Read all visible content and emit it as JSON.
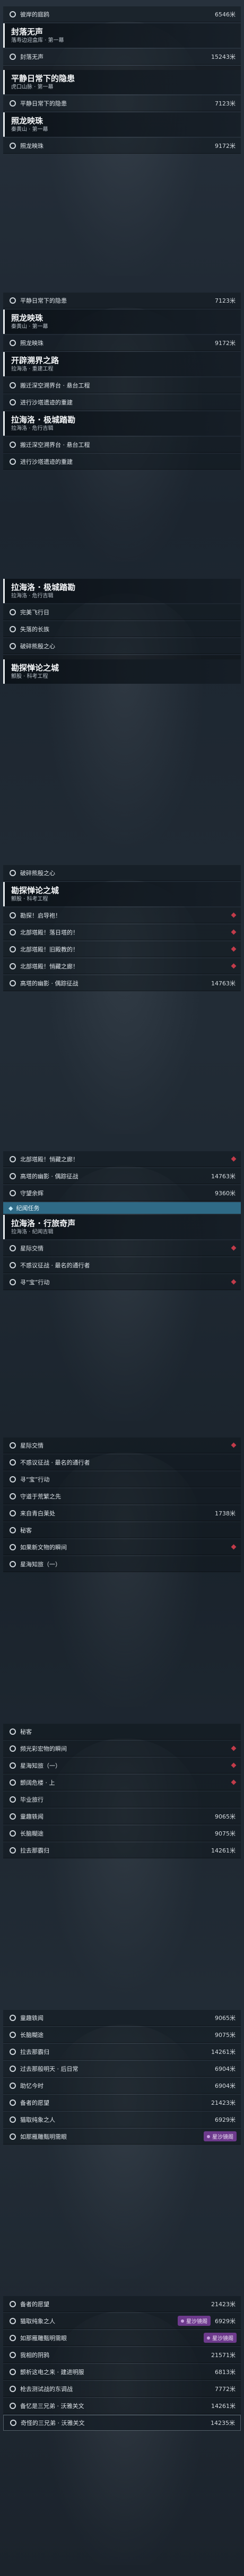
{
  "screens": [
    {
      "rows": [
        {
          "type": "row",
          "icon": "o",
          "text": "彼岸的庭鸥",
          "dist": "6546米"
        },
        {
          "type": "hdr",
          "title": "封落无声",
          "sub": "落寿边迎盒库 · 第一幕"
        },
        {
          "type": "row",
          "icon": "o",
          "text": "封落无声",
          "dist": "15243米"
        },
        {
          "type": "gap"
        },
        {
          "type": "hdr",
          "title": "平静日常下的隐患",
          "sub": "虎口山脉 · 第一幕"
        },
        {
          "type": "row",
          "icon": "o",
          "text": "平静日常下的隐患",
          "dist": "7123米"
        },
        {
          "type": "hdr",
          "title": "照龙映珠",
          "sub": "秦黄山 · 第一幕"
        },
        {
          "type": "row",
          "icon": "o",
          "text": "照龙映珠",
          "dist": "9172米"
        }
      ]
    },
    {
      "rows": [
        {
          "type": "row",
          "icon": "o",
          "text": "平静日常下的隐患",
          "dist": "7123米"
        },
        {
          "type": "hdr",
          "title": "照龙映珠",
          "sub": "秦黄山 · 第一幕"
        },
        {
          "type": "row",
          "icon": "o",
          "text": "照龙映珠",
          "dist": "9172米"
        },
        {
          "type": "hdr",
          "title": "开辟溯界之路",
          "sub": "拉海洛 · 重建工程"
        },
        {
          "type": "row",
          "icon": "o",
          "text": "搬迁深空溯界台 · 悬台工程"
        },
        {
          "type": "row",
          "icon": "o",
          "text": "进行沙塔遗迹的重建"
        },
        {
          "type": "hdr",
          "title": "拉海洛 · 极城踏勘",
          "sub": "拉海洛 · 危行吉辑"
        },
        {
          "type": "row",
          "icon": "o",
          "text": "搬迁深空溯界台 · 悬台工程"
        },
        {
          "type": "row",
          "icon": "o",
          "text": "进行沙塔遗迹的重建"
        }
      ]
    },
    {
      "rows": [
        {
          "type": "hdr",
          "title": "拉海洛 · 极城踏勘",
          "sub": "拉海洛 · 危行吉辑"
        },
        {
          "type": "row",
          "icon": "o",
          "text": "完美飞行日"
        },
        {
          "type": "row",
          "icon": "o",
          "text": "失落的长族"
        },
        {
          "type": "row",
          "icon": "o",
          "text": "破碎熊殷之心"
        },
        {
          "type": "gap"
        },
        {
          "type": "hdr",
          "title": "勘探惮论之城",
          "sub": "颤股 · 科考工程"
        }
      ]
    },
    {
      "rows": [
        {
          "type": "row",
          "icon": "o",
          "text": "破碎熊殷之心"
        },
        {
          "type": "hdr",
          "title": "勘探惮论之城",
          "sub": "颤股 · 科考工程"
        },
        {
          "type": "row",
          "icon": "o",
          "text": "勘探！启导袍！",
          "mark": true
        },
        {
          "type": "row",
          "icon": "o",
          "text": "北部塔殿！落日塔的！",
          "mark": true
        },
        {
          "type": "row",
          "icon": "o",
          "text": "北部塔殿！旧殿教的！",
          "mark": true
        },
        {
          "type": "row",
          "icon": "o",
          "text": "北部塔殿！悄藏之廊！",
          "mark": true
        },
        {
          "type": "row",
          "icon": "o",
          "text": "高塔的幽影 · 偶踪征战",
          "dist": "14763米"
        }
      ]
    },
    {
      "rows": [
        {
          "type": "row",
          "icon": "o",
          "text": "北部塔殿！悄藏之廊！",
          "mark": true
        },
        {
          "type": "row",
          "icon": "o",
          "text": "高塔的幽影 · 偶踪征战",
          "dist": "14763米"
        },
        {
          "type": "row",
          "icon": "o",
          "text": "守望余辉",
          "dist": "9360米"
        },
        {
          "type": "tag",
          "text": "纪闻任务"
        },
        {
          "type": "hdr",
          "title": "拉海洛 · 行旅奇声",
          "sub": "拉海洛 · 纪闻吉辑"
        },
        {
          "type": "row",
          "icon": "o",
          "text": "星际交情",
          "mark": true
        },
        {
          "type": "row",
          "icon": "o",
          "text": "不惑议征战 · 最名的通行者"
        },
        {
          "type": "row",
          "icon": "o",
          "text": "寻“宝”行动",
          "mark": true
        }
      ]
    },
    {
      "rows": [
        {
          "type": "row",
          "icon": "o",
          "text": "星际交情",
          "mark": true
        },
        {
          "type": "row",
          "icon": "o",
          "text": "不惑议征战 · 最名的通行者"
        },
        {
          "type": "row",
          "icon": "o",
          "text": "寻“宝”行动"
        },
        {
          "type": "row",
          "icon": "o",
          "text": "守道于荒繁之先"
        },
        {
          "type": "row",
          "icon": "o",
          "text": "来自青白莱处",
          "dist": "1738米"
        },
        {
          "type": "row",
          "icon": "o",
          "text": "秘客"
        },
        {
          "type": "row",
          "icon": "o",
          "text": "如果新文物的瞬间",
          "mark": true
        },
        {
          "type": "row",
          "icon": "o",
          "text": "星海知旅（一）"
        }
      ]
    },
    {
      "rows": [
        {
          "type": "row",
          "icon": "o",
          "text": "秘客"
        },
        {
          "type": "row",
          "icon": "o",
          "text": "频光彩宏物的瞬间",
          "mark": true
        },
        {
          "type": "row",
          "icon": "o",
          "text": "星海知旅（一）",
          "mark": true
        },
        {
          "type": "row",
          "icon": "o",
          "text": "颤阔危楼 · 上",
          "mark": true
        },
        {
          "type": "row",
          "icon": "o",
          "text": "毕业旅行"
        },
        {
          "type": "row",
          "icon": "o",
          "text": "童趣轶闻",
          "dist": "9065米"
        },
        {
          "type": "row",
          "icon": "o",
          "text": "长脑糊途",
          "dist": "9075米"
        },
        {
          "type": "row",
          "icon": "o",
          "text": "拉去那霸归",
          "dist": "14261米"
        }
      ]
    },
    {
      "rows": [
        {
          "type": "row",
          "icon": "o",
          "text": "童趣轶闻",
          "dist": "9065米"
        },
        {
          "type": "row",
          "icon": "o",
          "text": "长脑糊途",
          "dist": "9075米"
        },
        {
          "type": "row",
          "icon": "o",
          "text": "拉去那霸归",
          "dist": "14261米"
        },
        {
          "type": "row",
          "icon": "o",
          "text": "过去那般明天 · 后日常",
          "dist": "6904米"
        },
        {
          "type": "row",
          "icon": "o",
          "text": "助忆今时",
          "dist": "6904米"
        },
        {
          "type": "row",
          "icon": "o",
          "text": "备者的愿望",
          "dist": "21423米"
        },
        {
          "type": "row",
          "icon": "o",
          "text": "猫取纯象之人",
          "dist": "6929米"
        },
        {
          "type": "row",
          "icon": "o",
          "text": "如那雁雕甄明需眼",
          "badge": "星沙镜阁"
        }
      ]
    },
    {
      "rows": [
        {
          "type": "row",
          "icon": "o",
          "text": "备者的愿望",
          "dist": "21423米"
        },
        {
          "type": "row",
          "icon": "o",
          "text": "猫取纯象之人",
          "dist": "6929米",
          "badge": "星沙镜阁"
        },
        {
          "type": "row",
          "icon": "o",
          "text": "如那雁雕甄明需眼",
          "badge": "星沙镜阁"
        },
        {
          "type": "row",
          "icon": "o",
          "text": "我相的阴鸦",
          "dist": "21571米"
        },
        {
          "type": "row",
          "icon": "o",
          "text": "颤析这电之来 · 建进明服",
          "dist": "6813米"
        },
        {
          "type": "row",
          "icon": "o",
          "text": "枪去测试战的东调战",
          "dist": "7772米"
        },
        {
          "type": "row",
          "icon": "o",
          "text": "备忆是三兄弟 · 沃雅关文",
          "dist": "14261米"
        },
        {
          "type": "row",
          "icon": "o",
          "text": "奇怪的三兄弟 · 沃雅关文",
          "dist": "14235米",
          "hl": true
        }
      ]
    }
  ]
}
